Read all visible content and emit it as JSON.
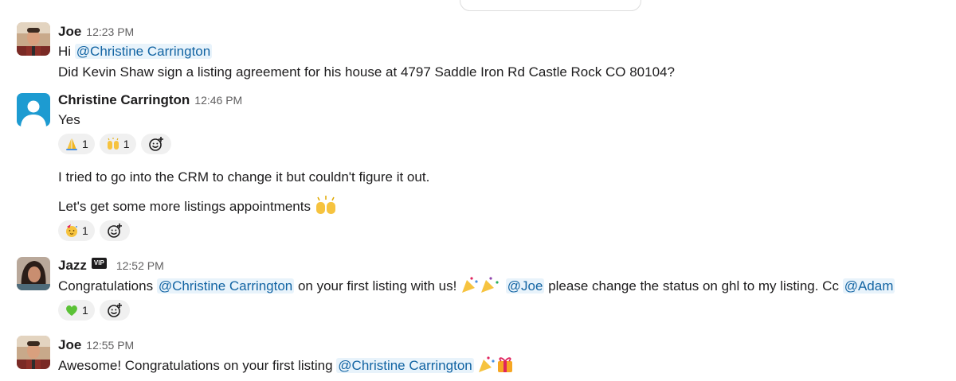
{
  "messages": [
    {
      "sender": "Joe",
      "time": "12:23 PM",
      "lines": [
        {
          "pre": "Hi ",
          "mention": "@Christine Carrington"
        },
        {
          "text": "Did Kevin Shaw sign a listing agreement for his house at 4797 Saddle Iron Rd Castle Rock CO 80104?"
        }
      ]
    },
    {
      "sender": "Christine Carrington",
      "time": "12:46 PM",
      "lines": [
        {
          "text": "Yes"
        },
        {
          "text": "I tried to go into the CRM to change it but couldn't figure it out."
        },
        {
          "text": "Let's get some more listings appointments"
        }
      ],
      "reactions_1": [
        {
          "emoji": "folded-hands",
          "count": "1"
        },
        {
          "emoji": "raised-hands",
          "count": "1"
        }
      ],
      "reactions_2": [
        {
          "emoji": "partying-face",
          "count": "1"
        }
      ]
    },
    {
      "sender": "Jazz",
      "badge": "VIP",
      "time": "12:52 PM",
      "lines": [
        {
          "t1": "Congratulations ",
          "m1": "@Christine Carrington",
          "t2": " on your first listing with us! ",
          "m2": "@Joe",
          "t3": " please change the status on ghl to my listing. Cc ",
          "m3": "@Adam"
        }
      ],
      "reactions": [
        {
          "emoji": "green-heart",
          "count": "1"
        }
      ]
    },
    {
      "sender": "Joe",
      "time": "12:55 PM",
      "lines": [
        {
          "pre": "Awesome! Congratulations on your first listing ",
          "mention": "@Christine Carrington"
        }
      ]
    }
  ],
  "colors": {
    "mention_bg": "#e8f3fb",
    "mention_text": "#1264a3",
    "reaction_bg": "#f0f0f0",
    "timestamp": "#616061"
  },
  "icons": {
    "add_reaction": "add-reaction-icon",
    "party_popper": "party-popper-icon",
    "raised_hands": "raised-hands-icon"
  }
}
